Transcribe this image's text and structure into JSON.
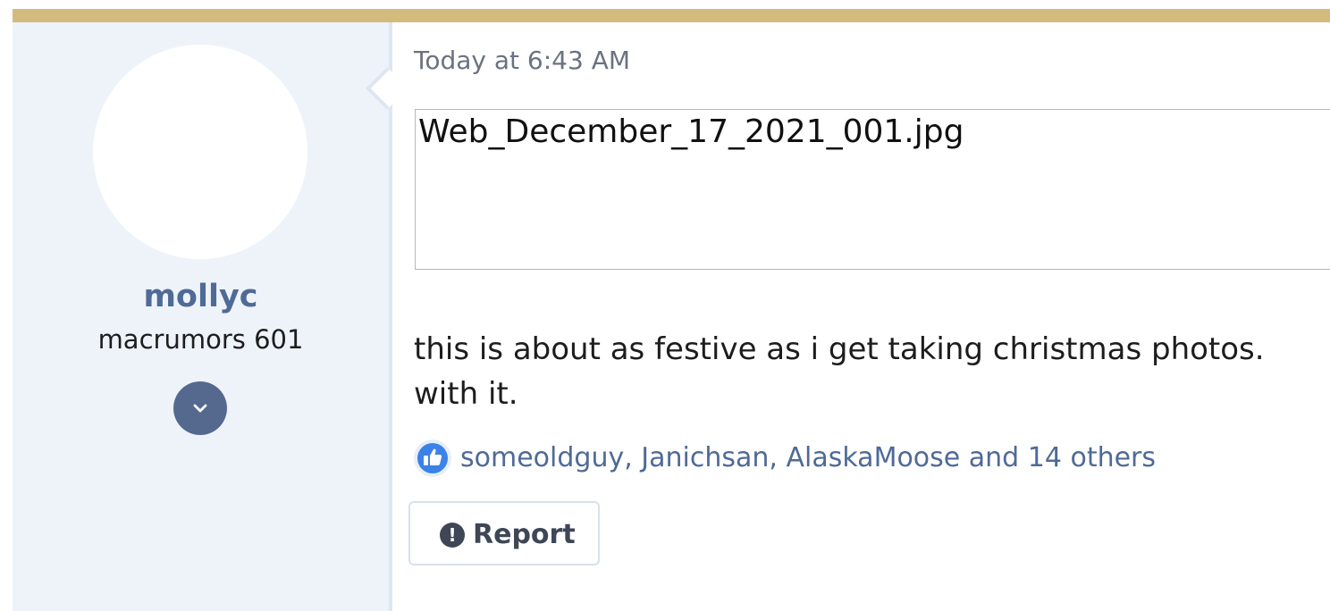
{
  "colors": {
    "accent_bar": "#d3bb7e",
    "username": "#4f6a97",
    "link": "#4f6a97",
    "user_panel": "#eef3fa",
    "like": "#3b82e8"
  },
  "user": {
    "name": "mollyc",
    "title": "macrumors 601",
    "expand_icon": "chevron-down-icon"
  },
  "post": {
    "timestamp": "Today at 6:43 AM",
    "attachment_name": "Web_December_17_2021_001.jpg",
    "message_line1": "this is about as festive as i get taking christmas photos. ",
    "message_line2": "with it."
  },
  "reactions": {
    "icon": "thumbs-up-icon",
    "text": "someoldguy, Janichsan, AlaskaMoose and 14 others"
  },
  "actions": {
    "report_icon": "exclamation-icon",
    "report_label": "Report"
  }
}
